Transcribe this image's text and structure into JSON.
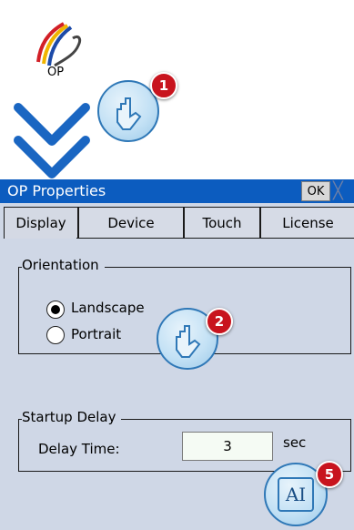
{
  "desktop": {
    "icon_label": "OP"
  },
  "steps": {
    "step1": "1",
    "step2": "2",
    "step5": "5"
  },
  "dialog": {
    "title": "OP Properties",
    "ok_label": "OK",
    "close_glyph": "╳",
    "tabs": [
      "Display",
      "Device",
      "Touch",
      "License"
    ],
    "active_tab": "Display",
    "orientation": {
      "title": "Orientation",
      "options": [
        "Landscape",
        "Portrait"
      ],
      "selected": "Landscape"
    },
    "startup": {
      "title": "Startup Delay",
      "delay_label": "Delay Time:",
      "delay_value": "3",
      "unit": "sec"
    }
  },
  "keyboard_icon_text": "AI",
  "colors": {
    "titlebar": "#0c5cbf",
    "dialog_bg": "#cfd7e6",
    "badge": "#c8141e",
    "arrow": "#1a66c2",
    "touch_border": "#2f78b7"
  }
}
